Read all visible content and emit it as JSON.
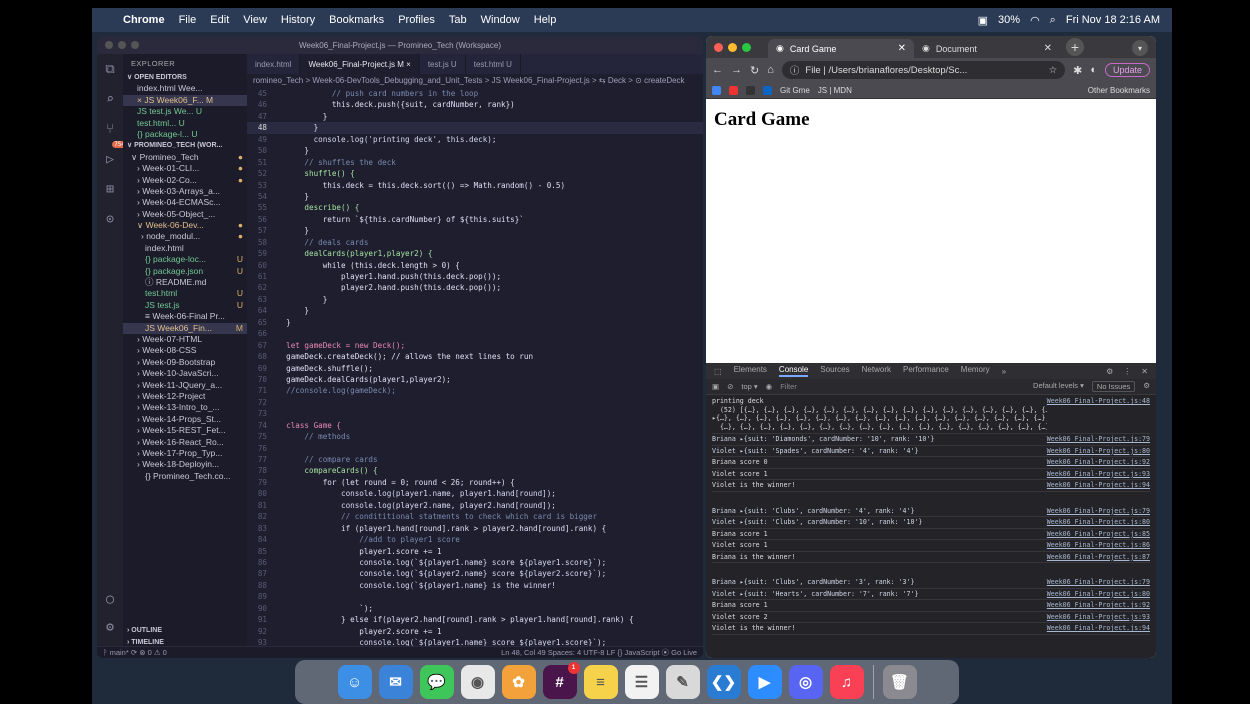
{
  "menubar": {
    "app": "Chrome",
    "items": [
      "File",
      "Edit",
      "View",
      "History",
      "Bookmarks",
      "Profiles",
      "Tab",
      "Window",
      "Help"
    ],
    "battery": "30%",
    "datetime": "Fri Nov 18  2:16 AM"
  },
  "vscode": {
    "title": "Week06_Final-Project.js — Promineo_Tech (Workspace)",
    "explorer_label": "EXPLORER",
    "open_editors_label": "OPEN EDITORS",
    "open_editors": [
      {
        "name": "index.html Wee...",
        "status": "",
        "cls": ""
      },
      {
        "name": "× JS Week06_F... M",
        "status": "",
        "cls": "git sel"
      },
      {
        "name": "JS test.js We... U",
        "status": "",
        "cls": "new"
      },
      {
        "name": "test.html... U",
        "status": "",
        "cls": "new"
      },
      {
        "name": "{} package-l... U",
        "status": "",
        "cls": "new"
      }
    ],
    "workspace_label": "PROMINEO_TECH (WOR...",
    "tree": [
      {
        "name": "∨ Promineo_Tech",
        "status": "●",
        "cls": ""
      },
      {
        "name": "› Week-01-CLI...",
        "status": "●",
        "cls": ""
      },
      {
        "name": "› Week-02-Co...",
        "status": "●",
        "cls": ""
      },
      {
        "name": "› Week-03-Arrays_a...",
        "status": "",
        "cls": ""
      },
      {
        "name": "› Week-04-ECMASc...",
        "status": "",
        "cls": ""
      },
      {
        "name": "› Week-05-Object_...",
        "status": "",
        "cls": ""
      },
      {
        "name": "∨ Week-06-Dev...",
        "status": "●",
        "cls": "git"
      },
      {
        "name": "› node_modul...",
        "status": "●",
        "cls": ""
      },
      {
        "name": "index.html",
        "status": "",
        "cls": ""
      },
      {
        "name": "{} package-loc...",
        "status": "U",
        "cls": "new"
      },
      {
        "name": "{} package.json",
        "status": "U",
        "cls": "new"
      },
      {
        "name": "ⓘ README.md",
        "status": "",
        "cls": ""
      },
      {
        "name": "test.html",
        "status": "U",
        "cls": "new"
      },
      {
        "name": "JS test.js",
        "status": "U",
        "cls": "new"
      },
      {
        "name": "≡ Week-06-Final Pr...",
        "status": "",
        "cls": ""
      },
      {
        "name": "JS Week06_Fin...",
        "status": "M",
        "cls": "git sel"
      },
      {
        "name": "› Week-07-HTML",
        "status": "",
        "cls": ""
      },
      {
        "name": "› Week-08-CSS",
        "status": "",
        "cls": ""
      },
      {
        "name": "› Week-09-Bootstrap",
        "status": "",
        "cls": ""
      },
      {
        "name": "› Week-10-JavaScri...",
        "status": "",
        "cls": ""
      },
      {
        "name": "› Week-11-JQuery_a...",
        "status": "",
        "cls": ""
      },
      {
        "name": "› Week-12-Project",
        "status": "",
        "cls": ""
      },
      {
        "name": "› Week-13-Intro_to_...",
        "status": "",
        "cls": ""
      },
      {
        "name": "› Week-14-Props_St...",
        "status": "",
        "cls": ""
      },
      {
        "name": "› Week-15-REST_Fet...",
        "status": "",
        "cls": ""
      },
      {
        "name": "› Week-16-React_Ro...",
        "status": "",
        "cls": ""
      },
      {
        "name": "› Week-17-Prop_Typ...",
        "status": "",
        "cls": ""
      },
      {
        "name": "› Week-18-Deployin...",
        "status": "",
        "cls": ""
      },
      {
        "name": "{} Promineo_Tech.co...",
        "status": "",
        "cls": ""
      }
    ],
    "outline_label": "OUTLINE",
    "timeline_label": "TIMELINE",
    "tabs": [
      {
        "label": "index.html",
        "active": false
      },
      {
        "label": "Week06_Final-Project.js M ×",
        "active": true
      },
      {
        "label": "test.js U",
        "active": false
      },
      {
        "label": "test.html U",
        "active": false
      }
    ],
    "breadcrumb": "romineo_Tech > Week-06-DevTools_Debugging_and_Unit_Tests > JS Week06_Final-Project.js > ⇆ Deck > ⊙ createDeck",
    "code": [
      {
        "n": "45",
        "t": "            // push card numbers in the loop"
      },
      {
        "n": "46",
        "t": "            this.deck.push({suit, cardNumber, rank})"
      },
      {
        "n": "47",
        "t": "          }"
      },
      {
        "n": "48",
        "t": "        }"
      },
      {
        "n": "49",
        "t": "        console.log('printing deck', this.deck);"
      },
      {
        "n": "50",
        "t": "      }"
      },
      {
        "n": "51",
        "t": "      // shuffles the deck"
      },
      {
        "n": "52",
        "t": "      shuffle() {"
      },
      {
        "n": "53",
        "t": "          this.deck = this.deck.sort(() => Math.random() - 0.5)"
      },
      {
        "n": "54",
        "t": "      }"
      },
      {
        "n": "55",
        "t": "      describe() {"
      },
      {
        "n": "56",
        "t": "          return `${this.cardNumber} of ${this.suits}`"
      },
      {
        "n": "57",
        "t": "      }"
      },
      {
        "n": "58",
        "t": "      // deals cards"
      },
      {
        "n": "59",
        "t": "      dealCards(player1,player2) {"
      },
      {
        "n": "60",
        "t": "          while (this.deck.length > 0) {"
      },
      {
        "n": "61",
        "t": "              player1.hand.push(this.deck.pop());"
      },
      {
        "n": "62",
        "t": "              player2.hand.push(this.deck.pop());"
      },
      {
        "n": "63",
        "t": "          }"
      },
      {
        "n": "64",
        "t": "      }"
      },
      {
        "n": "65",
        "t": "  }"
      },
      {
        "n": "66",
        "t": ""
      },
      {
        "n": "67",
        "t": "  let gameDeck = new Deck();"
      },
      {
        "n": "68",
        "t": "  gameDeck.createDeck(); // allows the next lines to run"
      },
      {
        "n": "69",
        "t": "  gameDeck.shuffle();"
      },
      {
        "n": "70",
        "t": "  gameDeck.dealCards(player1,player2);"
      },
      {
        "n": "71",
        "t": "  //console.log(gameDeck);"
      },
      {
        "n": "72",
        "t": ""
      },
      {
        "n": "73",
        "t": ""
      },
      {
        "n": "74",
        "t": "  class Game {"
      },
      {
        "n": "75",
        "t": "      // methods"
      },
      {
        "n": "76",
        "t": ""
      },
      {
        "n": "77",
        "t": "      // compare cards"
      },
      {
        "n": "78",
        "t": "      compareCards() {"
      },
      {
        "n": "79",
        "t": "          for (let round = 0; round < 26; round++) {"
      },
      {
        "n": "80",
        "t": "              console.log(player1.name, player1.hand[round]);"
      },
      {
        "n": "81",
        "t": "              console.log(player2.name, player2.hand[round]);"
      },
      {
        "n": "82",
        "t": "              // condititional statments to check which card is bigger"
      },
      {
        "n": "83",
        "t": "              if (player1.hand[round].rank > player2.hand[round].rank) {"
      },
      {
        "n": "84",
        "t": "                  //add to player1 score"
      },
      {
        "n": "85",
        "t": "                  player1.score += 1"
      },
      {
        "n": "86",
        "t": "                  console.log(`${player1.name} score ${player1.score}`);"
      },
      {
        "n": "87",
        "t": "                  console.log(`${player2.name} score ${player2.score}`);"
      },
      {
        "n": "88",
        "t": "                  console.log(`${player1.name} is the winner!"
      },
      {
        "n": "89",
        "t": ""
      },
      {
        "n": "90",
        "t": "                  `);"
      },
      {
        "n": "91",
        "t": "              } else if(player2.hand[round].rank > player1.hand[round].rank) {"
      },
      {
        "n": "92",
        "t": "                  player2.score += 1"
      },
      {
        "n": "93",
        "t": "                  console.log(`${player1.name} score ${player1.score}`);"
      }
    ],
    "current_line": "48",
    "status_left": "ᚹ main*  ⟳  ⊗ 0 ⚠ 0",
    "status_right": "Ln 48, Col 49   Spaces: 4   UTF-8   LF   {} JavaScript   ⦿ Go Live"
  },
  "chrome": {
    "tabs": [
      {
        "label": "Card Game",
        "active": true
      },
      {
        "label": "Document",
        "active": false
      }
    ],
    "address": "File  |  /Users/brianaflores/Desktop/Sc...",
    "update_label": "Update",
    "bookmarks": [
      "G",
      "Git Gme",
      "JS | MDN"
    ],
    "other_bookmarks": "Other Bookmarks",
    "page_heading": "Card Game"
  },
  "devtools": {
    "tabs": [
      "Elements",
      "Console",
      "Sources",
      "Network",
      "Performance",
      "Memory"
    ],
    "active_tab": "Console",
    "context": "top ▾",
    "filter_placeholder": "Filter",
    "levels": "Default levels ▾",
    "issues": "No Issues",
    "lines": [
      {
        "type": "multi",
        "msg": "printing deck\n  (52) [{…}, {…}, {…}, {…}, {…}, {…}, {…}, {…}, {…}, {…}, {…}, {…}, {…}, {…}, {…}, {…}, {…},\n▸{…}, {…}, {…}, {…}, {…}, {…}, {…}, {…}, {…}, {…}, {…}, {…}, {…}, {…}, {…}, {…}, {…},\n  {…}, {…}, {…}, {…}, {…}, {…}, {…}, {…}, {…}, {…}, {…}, {…}, {…}, {…}, {…}, {…}, {…}]",
        "src": "Week06_Final-Project.js:48"
      },
      {
        "type": "obj",
        "msg": "Briana ▸{suit: 'Diamonds', cardNumber: '10', rank: '10'}",
        "src": "Week06_Final-Project.js:79"
      },
      {
        "type": "obj",
        "msg": "Violet ▸{suit: 'Spades', cardNumber: '4', rank: '4'}",
        "src": "Week06_Final-Project.js:80"
      },
      {
        "type": "text",
        "msg": "Briana score 0",
        "src": "Week06_Final-Project.js:92"
      },
      {
        "type": "text",
        "msg": "Violet score 1",
        "src": "Week06_Final-Project.js:93"
      },
      {
        "type": "text",
        "msg": "Violet is the winner!",
        "src": "Week06_Final-Project.js:94"
      },
      {
        "type": "gap",
        "msg": "",
        "src": ""
      },
      {
        "type": "obj",
        "msg": "Briana ▸{suit: 'Clubs', cardNumber: '4', rank: '4'}",
        "src": "Week06_Final-Project.js:79"
      },
      {
        "type": "obj",
        "msg": "Violet ▸{suit: 'Clubs', cardNumber: '10', rank: '10'}",
        "src": "Week06_Final-Project.js:80"
      },
      {
        "type": "text",
        "msg": "Briana score 1",
        "src": "Week06_Final-Project.js:85"
      },
      {
        "type": "text",
        "msg": "Violet score 1",
        "src": "Week06_Final-Project.js:86"
      },
      {
        "type": "text",
        "msg": "Briana is the winner!",
        "src": "Week06_Final-Project.js:87"
      },
      {
        "type": "gap",
        "msg": "",
        "src": ""
      },
      {
        "type": "obj",
        "msg": "Briana ▸{suit: 'Clubs', cardNumber: '3', rank: '3'}",
        "src": "Week06_Final-Project.js:79"
      },
      {
        "type": "obj",
        "msg": "Violet ▸{suit: 'Hearts', cardNumber: '7', rank: '7'}",
        "src": "Week06_Final-Project.js:80"
      },
      {
        "type": "text",
        "msg": "Briana score 1",
        "src": "Week06_Final-Project.js:92"
      },
      {
        "type": "text",
        "msg": "Violet score 2",
        "src": "Week06_Final-Project.js:93"
      },
      {
        "type": "text",
        "msg": "Violet is the winner!",
        "src": "Week06_Final-Project.js:94"
      }
    ]
  },
  "dock": {
    "apps": [
      {
        "name": "finder-icon",
        "color": "#3d8fe6",
        "glyph": "☺"
      },
      {
        "name": "mail-icon",
        "color": "#3b82d9",
        "glyph": "✉"
      },
      {
        "name": "messages-icon",
        "color": "#3fc65a",
        "glyph": "💬"
      },
      {
        "name": "chrome-icon",
        "color": "#e8e8e8",
        "glyph": "◉"
      },
      {
        "name": "photos-icon",
        "color": "#f3a13a",
        "glyph": "✿"
      },
      {
        "name": "slack-icon",
        "color": "#4a154b",
        "glyph": "#"
      },
      {
        "name": "notes-icon",
        "color": "#f5d24a",
        "glyph": "≡"
      },
      {
        "name": "reminders-icon",
        "color": "#f2f2f2",
        "glyph": "☰"
      },
      {
        "name": "textedit-icon",
        "color": "#d9d9d9",
        "glyph": "✎"
      },
      {
        "name": "vscode-icon",
        "color": "#2a7cd3",
        "glyph": "❮❯"
      },
      {
        "name": "zoom-icon",
        "color": "#2d8cff",
        "glyph": "▶"
      },
      {
        "name": "discord-icon",
        "color": "#5865f2",
        "glyph": "◎"
      },
      {
        "name": "music-icon",
        "color": "#fa4055",
        "glyph": "♫"
      }
    ],
    "trash": {
      "name": "trash-icon",
      "color": "#8a8a90",
      "glyph": "🗑"
    },
    "slack_badge": "1"
  }
}
